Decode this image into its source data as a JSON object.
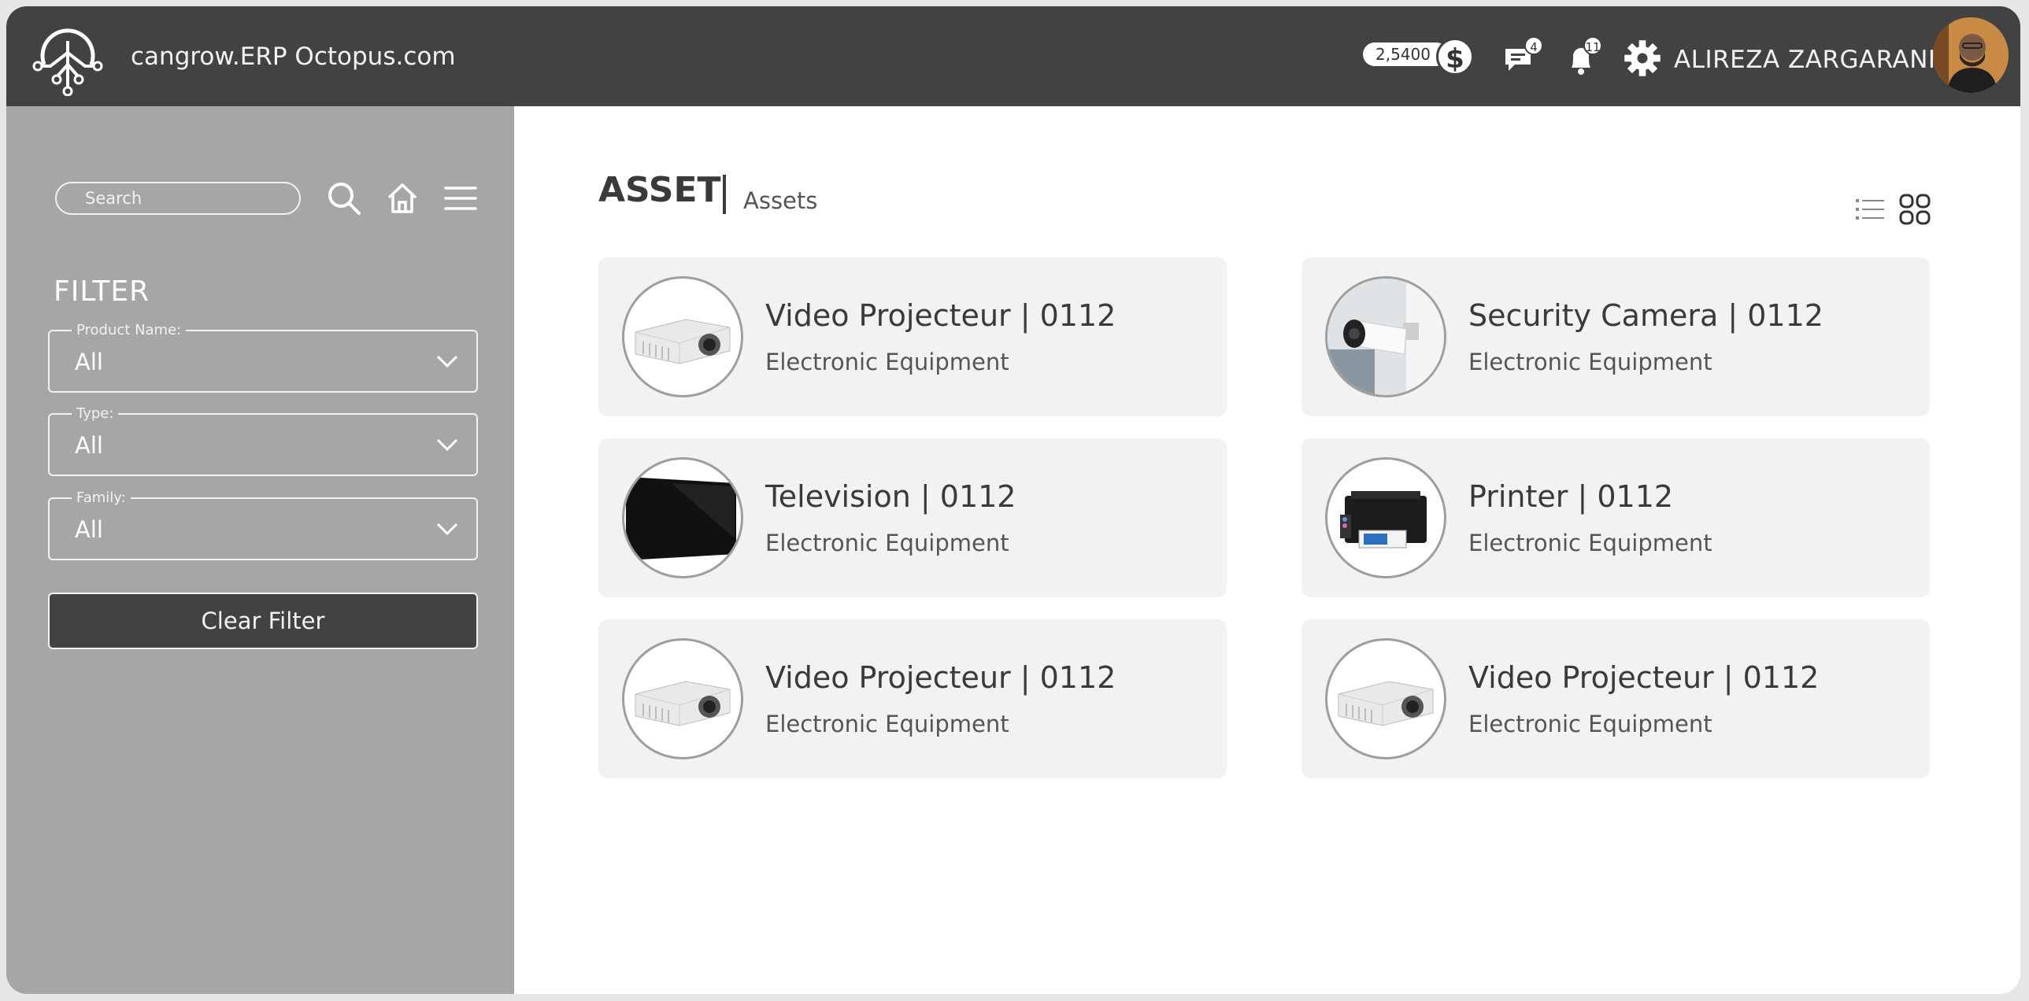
{
  "header": {
    "site_title": "cangrow.ERP Octopus.com",
    "balance": "2,5400",
    "currency_icon": "dollar-icon",
    "messages_count": "4",
    "notifications_count": "11",
    "user_name": "ALIREZA ZARGARANI"
  },
  "sidebar": {
    "search_placeholder": "Search",
    "filter_title": "FILTER",
    "filters": [
      {
        "label": "Product Name:",
        "value": "All"
      },
      {
        "label": "Type:",
        "value": "All"
      },
      {
        "label": "Family:",
        "value": "All"
      }
    ],
    "clear_label": "Clear Filter"
  },
  "main": {
    "title": "ASSET",
    "breadcrumb": "Assets",
    "view_modes": [
      "list-view-icon",
      "grid-view-icon"
    ],
    "cards": [
      {
        "title": "Video Projecteur | 0112",
        "subtitle": "Electronic Equipment",
        "image": "projector"
      },
      {
        "title": "Security Camera | 0112",
        "subtitle": "Electronic Equipment",
        "image": "camera"
      },
      {
        "title": "Television | 0112",
        "subtitle": "Electronic Equipment",
        "image": "television"
      },
      {
        "title": "Printer | 0112",
        "subtitle": "Electronic Equipment",
        "image": "printer"
      },
      {
        "title": "Video Projecteur | 0112",
        "subtitle": "Electronic Equipment",
        "image": "projector"
      },
      {
        "title": "Video Projecteur | 0112",
        "subtitle": "Electronic Equipment",
        "image": "projector"
      }
    ]
  },
  "colors": {
    "header_bg": "#424242",
    "sidebar_bg": "#a6a6a6",
    "card_bg": "#f2f2f2",
    "accent_dark": "#424242"
  }
}
